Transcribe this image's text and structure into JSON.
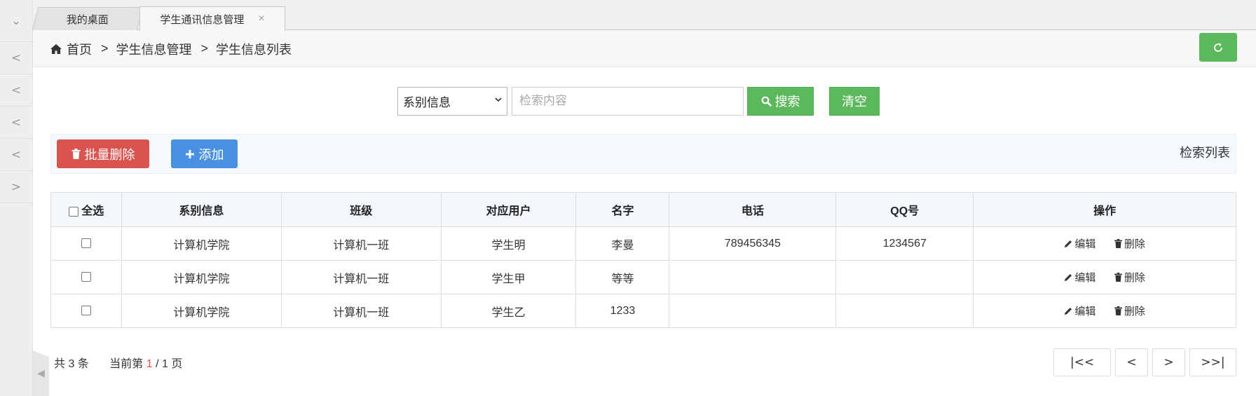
{
  "sidebar": {
    "items": [
      {
        "icon": "chevron-down-icon",
        "glyph": "⌄"
      },
      {
        "icon": "chevron-left-icon",
        "glyph": "<"
      },
      {
        "icon": "chevron-left-icon",
        "glyph": "<"
      },
      {
        "icon": "chevron-left-icon",
        "glyph": "<"
      },
      {
        "icon": "chevron-left-icon",
        "glyph": "<"
      },
      {
        "icon": "chevron-right-icon",
        "glyph": ">"
      }
    ]
  },
  "tabs": [
    {
      "label": "我的桌面"
    },
    {
      "label": "学生通讯信息管理",
      "close": "×"
    }
  ],
  "breadcrumb": {
    "home": "首页",
    "sep": ">",
    "level1": "学生信息管理",
    "level2": "学生信息列表"
  },
  "search": {
    "select_value": "系别信息",
    "placeholder": "检索内容",
    "search_label": "搜索",
    "clear_label": "清空"
  },
  "toolbar": {
    "batch_delete_label": "批量删除",
    "add_label": "添加",
    "list_label": "检索列表"
  },
  "table": {
    "headers": [
      "全选",
      "系别信息",
      "班级",
      "对应用户",
      "名字",
      "电话",
      "QQ号",
      "操作"
    ],
    "rows": [
      {
        "dept": "计算机学院",
        "class": "计算机一班",
        "user": "学生明",
        "name": "李曼",
        "phone": "789456345",
        "qq": "1234567"
      },
      {
        "dept": "计算机学院",
        "class": "计算机一班",
        "user": "学生甲",
        "name": "等等",
        "phone": "",
        "qq": ""
      },
      {
        "dept": "计算机学院",
        "class": "计算机一班",
        "user": "学生乙",
        "name": "1233",
        "phone": "",
        "qq": ""
      }
    ],
    "edit_label": "编辑",
    "delete_label": "删除"
  },
  "footer": {
    "total": "共 3 条",
    "current_prefix": "当前第",
    "current_page": "1",
    "page_total": "/ 1 页"
  },
  "pager": {
    "first": "|<<",
    "prev": "<",
    "next": ">",
    "last": ">>|"
  },
  "colors": {
    "green": "#5cb85c",
    "red": "#d9534f",
    "blue": "#4a90e2"
  }
}
